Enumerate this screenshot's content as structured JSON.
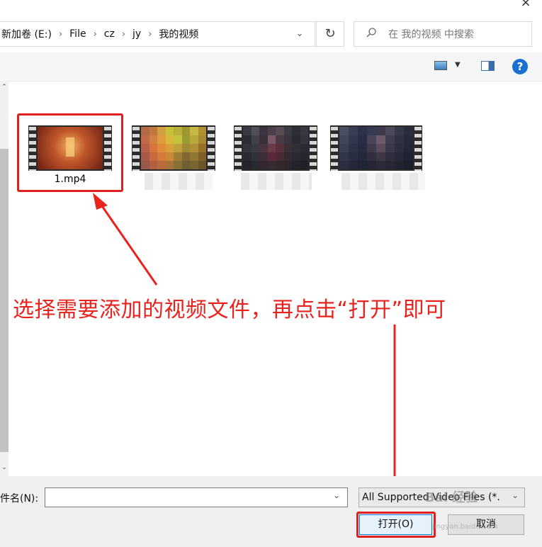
{
  "window": {
    "close_glyph": "×"
  },
  "breadcrumb": {
    "items": [
      "新加卷 (E:)",
      "File",
      "cz",
      "jy",
      "我的视频"
    ],
    "separator": "›"
  },
  "search": {
    "placeholder": "在 我的视频 中搜索"
  },
  "toolbar": {
    "help_label": "?",
    "icons": [
      "change-view-icon",
      "preview-pane-icon",
      "help-icon"
    ]
  },
  "files": [
    {
      "name": "1.mp4",
      "blurred": false,
      "selected": true
    },
    {
      "name": "",
      "blurred": true,
      "selected": false
    },
    {
      "name": "",
      "blurred": true,
      "selected": false
    },
    {
      "name": "",
      "blurred": true,
      "selected": false
    }
  ],
  "annotation": {
    "text": "选择需要添加的视频文件，再点击“打开”即可",
    "color": "#e8231d"
  },
  "bottom": {
    "filename_label": "件名(N):",
    "filename_value": "",
    "filter_value": "All Supported Video Files (*.",
    "open_label": "打开(O)",
    "cancel_label": "取消"
  },
  "watermark": {
    "text": "Bai 经验",
    "url_text": "jingyan.baidu.com"
  }
}
